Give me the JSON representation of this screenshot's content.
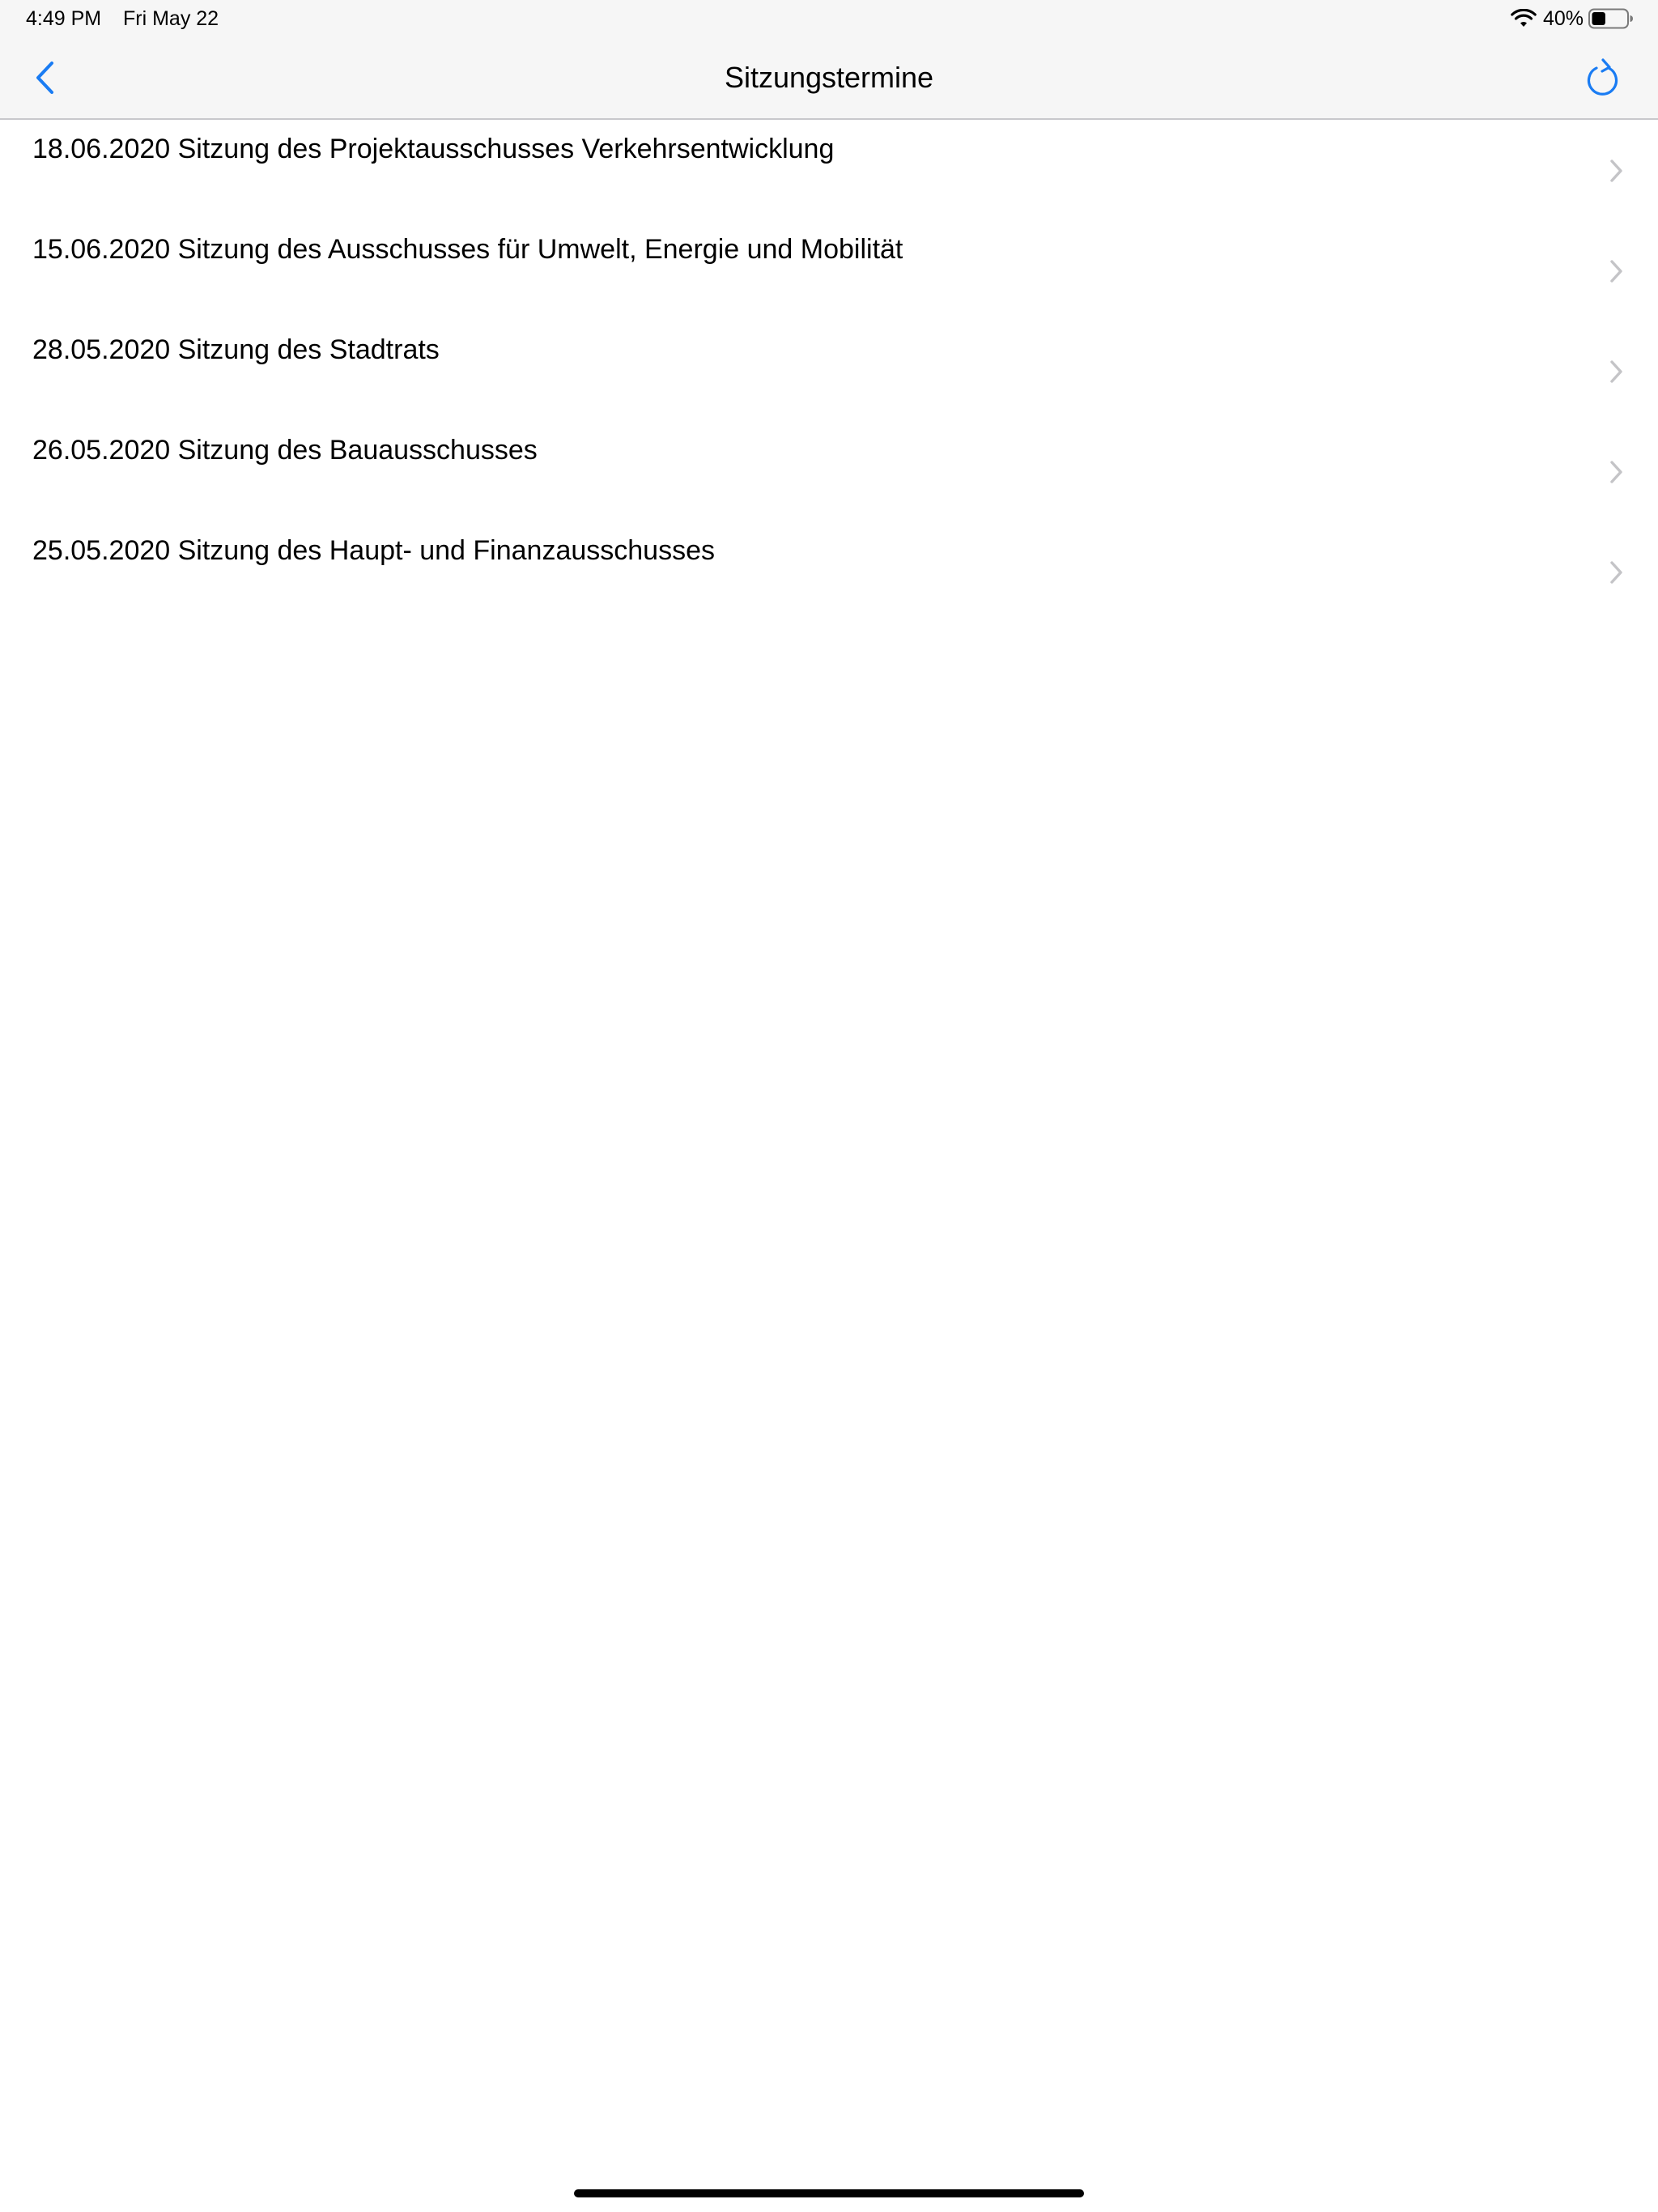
{
  "status_bar": {
    "time": "4:49 PM",
    "date": "Fri May 22",
    "battery_percent": "40%",
    "battery_level": 0.4,
    "wifi_icon": "wifi-icon",
    "battery_icon": "battery-icon"
  },
  "nav": {
    "title": "Sitzungstermine",
    "back_icon": "chevron-left-icon",
    "refresh_icon": "refresh-icon"
  },
  "colors": {
    "accent": "#1a7cf3",
    "chevron": "#c4c4c7",
    "bar_background": "#f6f6f6",
    "separator": "#c8c8cc"
  },
  "meetings": [
    {
      "label": "18.06.2020 Sitzung des Projektausschusses Verkehrsentwicklung"
    },
    {
      "label": "15.06.2020 Sitzung des Ausschusses für Umwelt, Energie und Mobilität"
    },
    {
      "label": "28.05.2020 Sitzung des Stadtrats"
    },
    {
      "label": "26.05.2020 Sitzung des Bauausschusses"
    },
    {
      "label": "25.05.2020 Sitzung des Haupt- und Finanzausschusses"
    }
  ]
}
